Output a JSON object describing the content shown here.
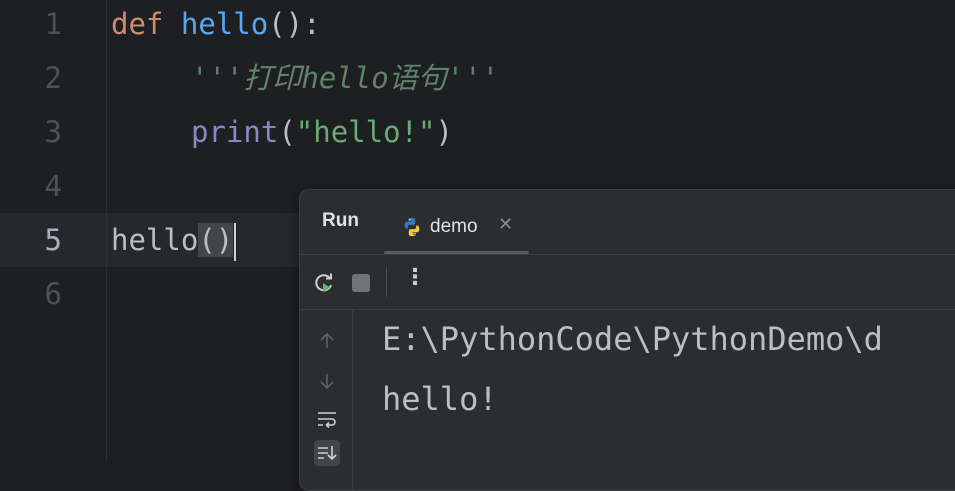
{
  "editor": {
    "line_numbers": [
      "1",
      "2",
      "3",
      "4",
      "5",
      "6"
    ],
    "lines": {
      "l1": {
        "kw": "def",
        "fn": "hello",
        "rest": "():"
      },
      "l2": {
        "doc": "'''打印hello语句'''"
      },
      "l3": {
        "fn": "print",
        "open": "(",
        "str": "\"hello!\"",
        "close": ")"
      },
      "l5": {
        "name": "hello",
        "parens": "()"
      }
    }
  },
  "run_panel": {
    "title": "Run",
    "tab": {
      "label": "demo",
      "icon": "python-icon",
      "close_icon": "close-icon"
    },
    "toolbar": {
      "rerun_icon": "rerun-icon",
      "stop_icon": "stop-icon",
      "more_icon": "more-vertical-icon"
    },
    "side_icons": [
      "arrow-up-icon",
      "arrow-down-icon",
      "soft-wrap-icon",
      "scroll-to-end-icon"
    ],
    "console": [
      "E:\\PythonCode\\PythonDemo\\d",
      "hello!"
    ]
  },
  "colors": {
    "background": "#1e1f22",
    "keyword": "#cf8e6d",
    "function": "#56a8f5",
    "builtin": "#8888c6",
    "string": "#6aab73",
    "docstring": "#5f826b",
    "panel": "#2b2d30"
  }
}
